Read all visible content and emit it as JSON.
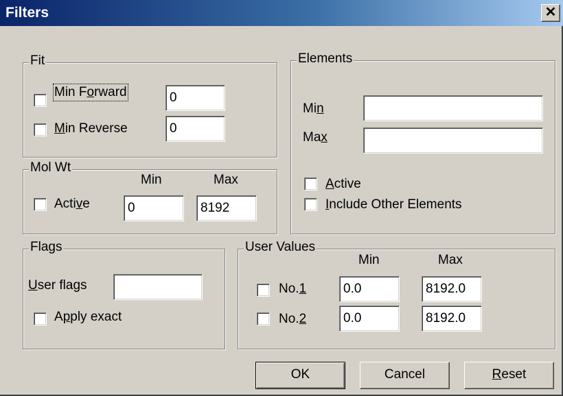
{
  "window": {
    "title": "Filters",
    "close_glyph": "✕"
  },
  "fit": {
    "legend": "Fit",
    "min_forward": {
      "label_pre": "Min F",
      "label_acc": "o",
      "label_post": "rward",
      "value": "0"
    },
    "min_reverse": {
      "label_pre": "",
      "label_acc": "M",
      "label_post": "in Reverse",
      "value": "0"
    }
  },
  "mol_wt": {
    "legend": "Mol Wt",
    "min_header": "Min",
    "max_header": "Max",
    "active": {
      "label_pre": "Acti",
      "label_acc": "v",
      "label_post": "e"
    },
    "min_value": "0",
    "max_value": "8192"
  },
  "elements": {
    "legend": "Elements",
    "min": {
      "label_pre": "Mi",
      "label_acc": "n",
      "label_post": "",
      "value": ""
    },
    "max": {
      "label_pre": "Ma",
      "label_acc": "x",
      "label_post": "",
      "value": ""
    },
    "active": {
      "label_pre": "",
      "label_acc": "A",
      "label_post": "ctive"
    },
    "include_other": {
      "label_pre": "",
      "label_acc": "I",
      "label_post": "nclude Other Elements"
    }
  },
  "flags": {
    "legend": "Flags",
    "user_flags": {
      "label_pre": "",
      "label_acc": "U",
      "label_post": "ser flags",
      "value": ""
    },
    "apply_exact": {
      "label_pre": "A",
      "label_acc": "p",
      "label_post": "ply exact"
    }
  },
  "user_values": {
    "legend": "User Values",
    "min_header": "Min",
    "max_header": "Max",
    "rows": [
      {
        "label_pre": "No.",
        "label_acc": "1",
        "min": "0.0",
        "max": "8192.0"
      },
      {
        "label_pre": "No.",
        "label_acc": "2",
        "min": "0.0",
        "max": "8192.0"
      }
    ]
  },
  "buttons": {
    "ok": "OK",
    "cancel": "Cancel",
    "reset_acc": "R",
    "reset_post": "eset"
  }
}
